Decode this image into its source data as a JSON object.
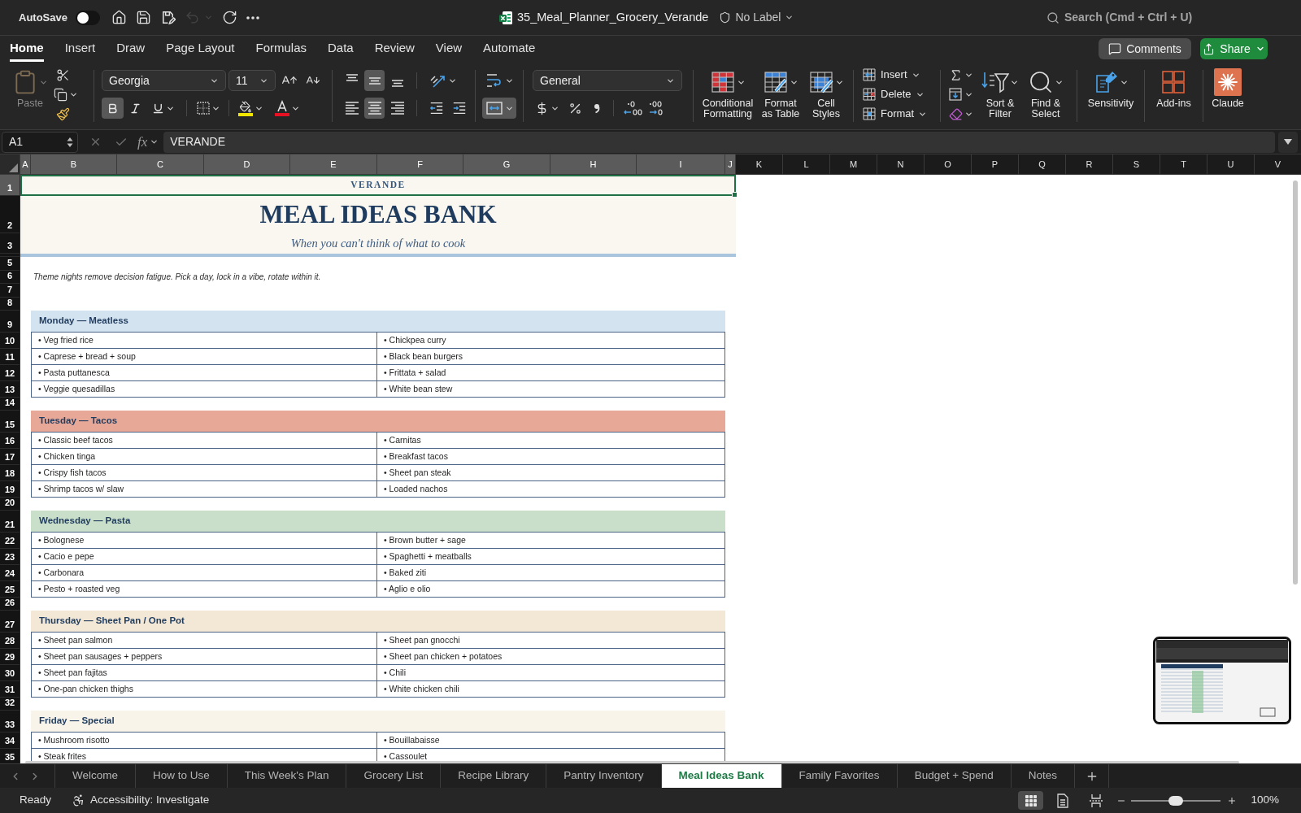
{
  "title_bar": {
    "autosave": {
      "label": "AutoSave",
      "on": false
    },
    "quick_access": [
      {
        "kind": "home",
        "disabled": false
      },
      {
        "kind": "save",
        "disabled": false
      },
      {
        "kind": "save_as",
        "disabled": false
      },
      {
        "kind": "undo",
        "disabled": true
      },
      {
        "kind": "redo",
        "disabled": false
      },
      {
        "kind": "more",
        "disabled": false
      }
    ],
    "file_name": "35_Meal_Planner_Grocery_Verande",
    "sensitivity": "No Label",
    "search": {
      "placeholder": "Search (Cmd + Ctrl + U)"
    }
  },
  "ribbon_tabs": [
    {
      "label": "Home",
      "selected": true
    },
    {
      "label": "Insert",
      "selected": false
    },
    {
      "label": "Draw",
      "selected": false
    },
    {
      "label": "Page Layout",
      "selected": false
    },
    {
      "label": "Formulas",
      "selected": false
    },
    {
      "label": "Data",
      "selected": false
    },
    {
      "label": "Review",
      "selected": false
    },
    {
      "label": "View",
      "selected": false
    },
    {
      "label": "Automate",
      "selected": false
    }
  ],
  "comments_button": {
    "label": "Comments"
  },
  "share_button": {
    "label": "Share"
  },
  "ribbon": {
    "paste": {
      "label": "Paste",
      "disabled": true
    },
    "font_name": "Georgia",
    "font_size": "11",
    "font_styles": [
      {
        "kind": "bold",
        "selected": true
      },
      {
        "kind": "italic",
        "selected": false
      },
      {
        "kind": "underline",
        "selected": false
      }
    ],
    "vertical_align": [
      {
        "kind": "top",
        "selected": false
      },
      {
        "kind": "middle",
        "selected": true
      },
      {
        "kind": "bottom",
        "selected": false
      }
    ],
    "horizontal_align": [
      {
        "kind": "left",
        "selected": false
      },
      {
        "kind": "center",
        "selected": true
      },
      {
        "kind": "right",
        "selected": false
      }
    ],
    "merge_center": {
      "selected": true
    },
    "number_format": "General",
    "style_buttons": [
      {
        "kind": "conditional_formatting",
        "lines": [
          "Conditional",
          "Formatting"
        ]
      },
      {
        "kind": "format_as_table",
        "lines": [
          "Format",
          "as Table"
        ]
      },
      {
        "kind": "cell_styles",
        "lines": [
          "Cell",
          "Styles"
        ]
      }
    ],
    "cell_buttons": [
      {
        "kind": "insert",
        "label": "Insert"
      },
      {
        "kind": "delete",
        "label": "Delete"
      },
      {
        "kind": "format",
        "label": "Format"
      }
    ],
    "edit_buttons": [
      {
        "kind": "sort_filter",
        "lines": [
          "Sort &",
          "Filter"
        ]
      },
      {
        "kind": "find_select",
        "lines": [
          "Find &",
          "Select"
        ]
      }
    ],
    "addin_buttons": [
      {
        "kind": "sensitivity",
        "lines": [
          "Sensitivity"
        ]
      },
      {
        "kind": "add_ins",
        "lines": [
          "Add-ins"
        ]
      },
      {
        "kind": "claude",
        "lines": [
          "Claude"
        ]
      }
    ]
  },
  "formula_bar": {
    "name_box": "A1",
    "function_label": "fx",
    "formula": "VERANDE"
  },
  "sheet": {
    "columns": [
      {
        "label": "A",
        "selected": true
      },
      {
        "label": "B",
        "selected": true
      },
      {
        "label": "C",
        "selected": true
      },
      {
        "label": "D",
        "selected": true
      },
      {
        "label": "E",
        "selected": true
      },
      {
        "label": "F",
        "selected": true
      },
      {
        "label": "G",
        "selected": true
      },
      {
        "label": "H",
        "selected": true
      },
      {
        "label": "I",
        "selected": true
      },
      {
        "label": "J",
        "selected": true
      },
      {
        "label": "K",
        "selected": false
      },
      {
        "label": "L",
        "selected": false
      },
      {
        "label": "M",
        "selected": false
      },
      {
        "label": "N",
        "selected": false
      },
      {
        "label": "O",
        "selected": false
      },
      {
        "label": "P",
        "selected": false
      },
      {
        "label": "Q",
        "selected": false
      },
      {
        "label": "R",
        "selected": false
      },
      {
        "label": "S",
        "selected": false
      },
      {
        "label": "T",
        "selected": false
      },
      {
        "label": "U",
        "selected": false
      },
      {
        "label": "V",
        "selected": false
      }
    ],
    "rows": [
      {
        "number": "1",
        "kind": "brand",
        "text": "VERANDE",
        "selected": true
      },
      {
        "number": "2",
        "kind": "title",
        "text": "MEAL IDEAS BANK",
        "selected": false
      },
      {
        "number": "3",
        "kind": "subtitle",
        "text": "When you can't think of what to cook",
        "selected": false
      },
      {
        "kind": "rule",
        "selected": false
      },
      {
        "number": "5",
        "kind": "blank",
        "selected": false
      },
      {
        "number": "6",
        "kind": "note",
        "text": "Theme nights remove decision fatigue. Pick a day, lock in a vibe, rotate within it.",
        "selected": false
      },
      {
        "number": "7",
        "kind": "blank",
        "selected": false
      },
      {
        "number": "8",
        "kind": "blank",
        "selected": false
      },
      {
        "number": "9",
        "kind": "section",
        "text": "Monday — Meatless",
        "color": "#d4e3f0",
        "selected": false
      },
      {
        "number": "10",
        "kind": "item",
        "cells": [
          "• Veg fried rice",
          "• Chickpea curry"
        ],
        "selected": false
      },
      {
        "number": "11",
        "kind": "item",
        "cells": [
          "• Caprese + bread + soup",
          "• Black bean burgers"
        ],
        "selected": false
      },
      {
        "number": "12",
        "kind": "item",
        "cells": [
          "• Pasta puttanesca",
          "• Frittata + salad"
        ],
        "selected": false
      },
      {
        "number": "13",
        "kind": "item",
        "cells": [
          "• Veggie quesadillas",
          "• White bean stew"
        ],
        "selected": false
      },
      {
        "number": "14",
        "kind": "blank",
        "selected": false
      },
      {
        "number": "15",
        "kind": "section",
        "text": "Tuesday — Tacos",
        "color": "#e8a898",
        "selected": false
      },
      {
        "number": "16",
        "kind": "item",
        "cells": [
          "• Classic beef tacos",
          "• Carnitas"
        ],
        "selected": false
      },
      {
        "number": "17",
        "kind": "item",
        "cells": [
          "• Chicken tinga",
          "• Breakfast tacos"
        ],
        "selected": false
      },
      {
        "number": "18",
        "kind": "item",
        "cells": [
          "• Crispy fish tacos",
          "• Sheet pan steak"
        ],
        "selected": false
      },
      {
        "number": "19",
        "kind": "item",
        "cells": [
          "• Shrimp tacos w/ slaw",
          "• Loaded nachos"
        ],
        "selected": false
      },
      {
        "number": "20",
        "kind": "blank",
        "selected": false
      },
      {
        "number": "21",
        "kind": "section",
        "text": "Wednesday — Pasta",
        "color": "#c9dfc9",
        "selected": false
      },
      {
        "number": "22",
        "kind": "item",
        "cells": [
          "• Bolognese",
          "• Brown butter + sage"
        ],
        "selected": false
      },
      {
        "number": "23",
        "kind": "item",
        "cells": [
          "• Cacio e pepe",
          "• Spaghetti + meatballs"
        ],
        "selected": false
      },
      {
        "number": "24",
        "kind": "item",
        "cells": [
          "• Carbonara",
          "• Baked ziti"
        ],
        "selected": false
      },
      {
        "number": "25",
        "kind": "item",
        "cells": [
          "• Pesto + roasted veg",
          "• Aglio e olio"
        ],
        "selected": false
      },
      {
        "number": "26",
        "kind": "blank",
        "selected": false
      },
      {
        "number": "27",
        "kind": "section",
        "text": "Thursday — Sheet Pan / One Pot",
        "color": "#f3e8d6",
        "selected": false
      },
      {
        "number": "28",
        "kind": "item",
        "cells": [
          "• Sheet pan salmon",
          "• Sheet pan gnocchi"
        ],
        "selected": false
      },
      {
        "number": "29",
        "kind": "item",
        "cells": [
          "• Sheet pan sausages + peppers",
          "• Sheet pan chicken + potatoes"
        ],
        "selected": false
      },
      {
        "number": "30",
        "kind": "item",
        "cells": [
          "• Sheet pan fajitas",
          "• Chili"
        ],
        "selected": false
      },
      {
        "number": "31",
        "kind": "item",
        "cells": [
          "• One-pan chicken thighs",
          "• White chicken chili"
        ],
        "selected": false
      },
      {
        "number": "32",
        "kind": "blank",
        "selected": false
      },
      {
        "number": "33",
        "kind": "section",
        "text": "Friday — Special",
        "color": "#f8f4e9",
        "selected": false
      },
      {
        "number": "34",
        "kind": "item",
        "cells": [
          "• Mushroom risotto",
          "• Bouillabaisse"
        ],
        "selected": false
      },
      {
        "number": "35",
        "kind": "item",
        "cells": [
          "• Steak frites",
          "• Cassoulet"
        ],
        "selected": false
      }
    ]
  },
  "sheet_tabs": [
    {
      "label": "Welcome",
      "selected": false
    },
    {
      "label": "How to Use",
      "selected": false
    },
    {
      "label": "This Week's Plan",
      "selected": false
    },
    {
      "label": "Grocery List",
      "selected": false
    },
    {
      "label": "Recipe Library",
      "selected": false
    },
    {
      "label": "Pantry Inventory",
      "selected": false
    },
    {
      "label": "Meal Ideas Bank",
      "selected": true
    },
    {
      "label": "Family Favorites",
      "selected": false
    },
    {
      "label": "Budget + Spend",
      "selected": false
    },
    {
      "label": "Notes",
      "selected": false
    }
  ],
  "status_bar": {
    "status": "Ready",
    "accessibility": "Accessibility: Investigate",
    "views": [
      {
        "kind": "normal",
        "selected": true
      },
      {
        "kind": "page_layout",
        "selected": false
      },
      {
        "kind": "page_break",
        "selected": false
      }
    ],
    "zoom": {
      "level": 0.5,
      "reading": "100%"
    }
  }
}
